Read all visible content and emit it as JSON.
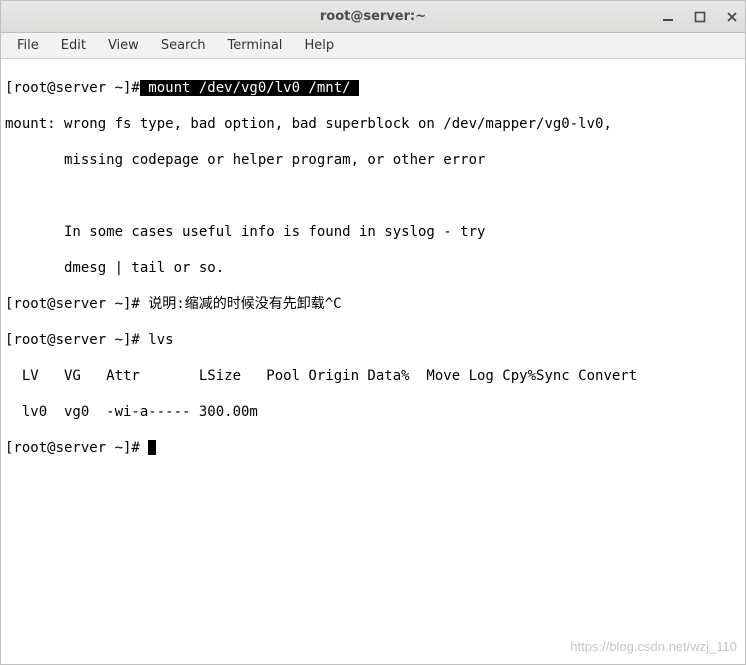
{
  "window": {
    "title": "root@server:~"
  },
  "menu": {
    "file": "File",
    "edit": "Edit",
    "view": "View",
    "search": "Search",
    "terminal": "Terminal",
    "help": "Help"
  },
  "term": {
    "p1_prompt": "[root@server ~]#",
    "p1_cmd": " mount /dev/vg0/lv0 /mnt/ ",
    "l2": "mount: wrong fs type, bad option, bad superblock on /dev/mapper/vg0-lv0,",
    "l3": "       missing codepage or helper program, or other error",
    "l4": "",
    "l5": "       In some cases useful info is found in syslog - try",
    "l6": "       dmesg | tail or so.",
    "l7": "[root@server ~]# 说明:缩减的时候没有先卸载^C",
    "l8": "[root@server ~]# lvs",
    "l9": "  LV   VG   Attr       LSize   Pool Origin Data%  Move Log Cpy%Sync Convert",
    "l10": "  lv0  vg0  -wi-a----- 300.00m",
    "l11_prompt": "[root@server ~]# "
  },
  "watermark": "https://blog.csdn.net/wzj_110"
}
